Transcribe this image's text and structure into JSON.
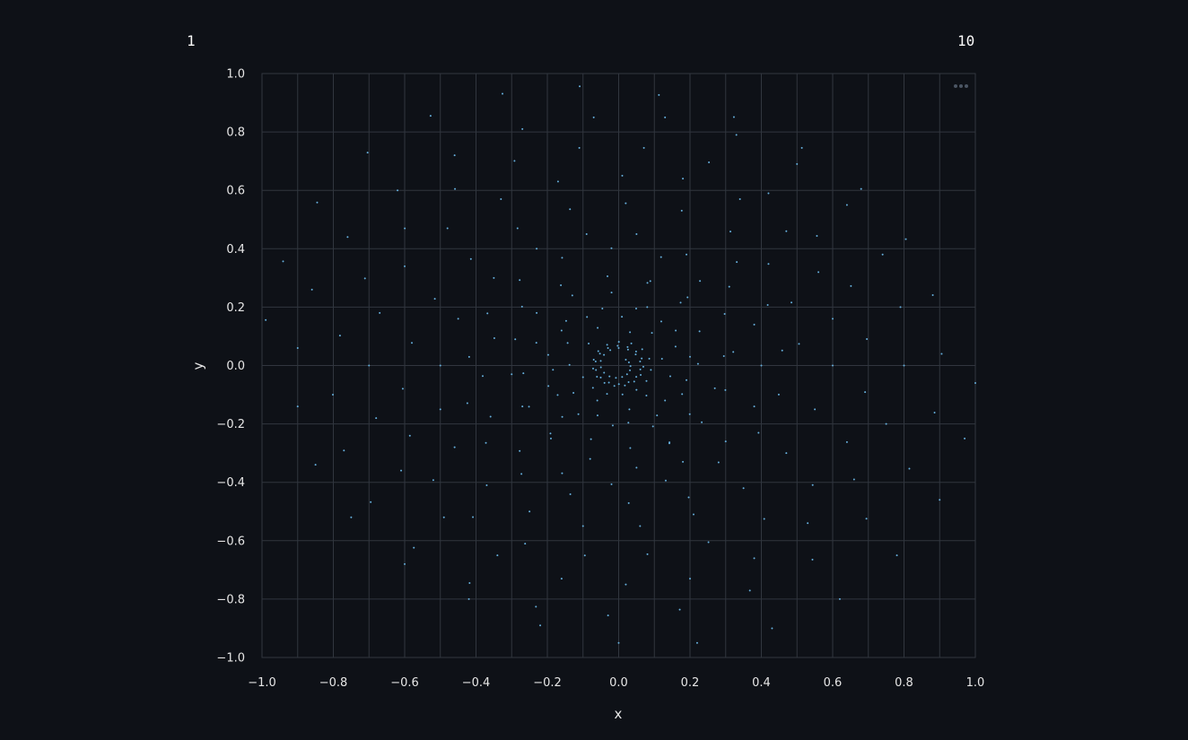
{
  "slider": {
    "min_label": "1",
    "max_label": "10"
  },
  "colors": {
    "background": "#0e1117",
    "grid": "#31363f",
    "point": "#66b0dd",
    "text": "#e6e6e6"
  },
  "chart_data": {
    "type": "scatter",
    "xlabel": "x",
    "ylabel": "y",
    "xlim": [
      -1.0,
      1.0
    ],
    "ylim": [
      -1.0,
      1.0
    ],
    "xticks": [
      "−1.0",
      "−0.8",
      "−0.6",
      "−0.4",
      "−0.2",
      "0.0",
      "0.2",
      "0.4",
      "0.6",
      "0.8",
      "1.0"
    ],
    "yticks": [
      "1.0",
      "0.8",
      "0.6",
      "0.4",
      "0.2",
      "0.0",
      "−0.2",
      "−0.4",
      "−0.6",
      "−0.8",
      "−1.0"
    ],
    "grid": true,
    "series": [
      {
        "shape": "archimedean-spiral",
        "x": [
          0.02,
          0.0,
          -0.03,
          -0.07,
          -0.1,
          -0.06,
          0.03,
          0.13,
          0.19,
          0.2,
          0.16,
          0.08,
          -0.02,
          -0.13,
          -0.23,
          -0.29,
          -0.3,
          -0.27,
          -0.19,
          -0.08,
          0.05,
          0.18,
          0.3,
          0.38,
          0.4,
          0.38,
          0.31,
          0.19,
          0.05,
          -0.09,
          -0.23,
          -0.35,
          -0.45,
          -0.5,
          -0.5,
          -0.46,
          -0.37,
          -0.25,
          -0.1,
          0.06,
          0.21,
          0.35,
          0.47,
          0.55,
          0.6,
          0.6,
          0.56,
          0.47,
          0.34,
          0.18,
          0.01,
          -0.17,
          -0.33,
          -0.48,
          -0.6,
          -0.67,
          -0.7,
          -0.68,
          -0.61,
          -0.49,
          -0.34,
          -0.16,
          0.02,
          0.2,
          0.38,
          0.53,
          0.66,
          0.75,
          0.8,
          0.79,
          0.74,
          0.64,
          0.5,
          0.33,
          0.13,
          -0.07,
          -0.27,
          -0.46,
          -0.62,
          -0.76,
          -0.86,
          -0.9,
          -0.9,
          -0.85,
          -0.75,
          -0.6,
          -0.42,
          -0.22,
          0.0,
          0.22,
          0.43,
          0.62,
          0.78,
          0.9,
          0.97,
          1.0
        ],
        "y": [
          0.02,
          0.06,
          0.06,
          0.02,
          -0.04,
          -0.12,
          -0.15,
          -0.12,
          -0.05,
          0.03,
          0.12,
          0.2,
          0.25,
          0.24,
          0.18,
          0.09,
          -0.03,
          -0.14,
          -0.25,
          -0.32,
          -0.35,
          -0.33,
          -0.26,
          -0.14,
          0.0,
          0.14,
          0.27,
          0.38,
          0.45,
          0.45,
          0.4,
          0.3,
          0.16,
          0.0,
          -0.15,
          -0.28,
          -0.41,
          -0.5,
          -0.55,
          -0.55,
          -0.51,
          -0.42,
          -0.3,
          -0.15,
          0.0,
          0.16,
          0.32,
          0.46,
          0.57,
          0.64,
          0.65,
          0.63,
          0.57,
          0.47,
          0.34,
          0.18,
          0.0,
          -0.18,
          -0.36,
          -0.52,
          -0.65,
          -0.73,
          -0.75,
          -0.73,
          -0.66,
          -0.54,
          -0.39,
          -0.2,
          0.0,
          0.2,
          0.38,
          0.55,
          0.69,
          0.79,
          0.85,
          0.85,
          0.81,
          0.72,
          0.6,
          0.44,
          0.26,
          0.06,
          -0.14,
          -0.34,
          -0.52,
          -0.68,
          -0.8,
          -0.89,
          -0.95,
          -0.95,
          -0.9,
          -0.8,
          -0.65,
          -0.46,
          -0.25,
          -0.06
        ]
      }
    ]
  }
}
